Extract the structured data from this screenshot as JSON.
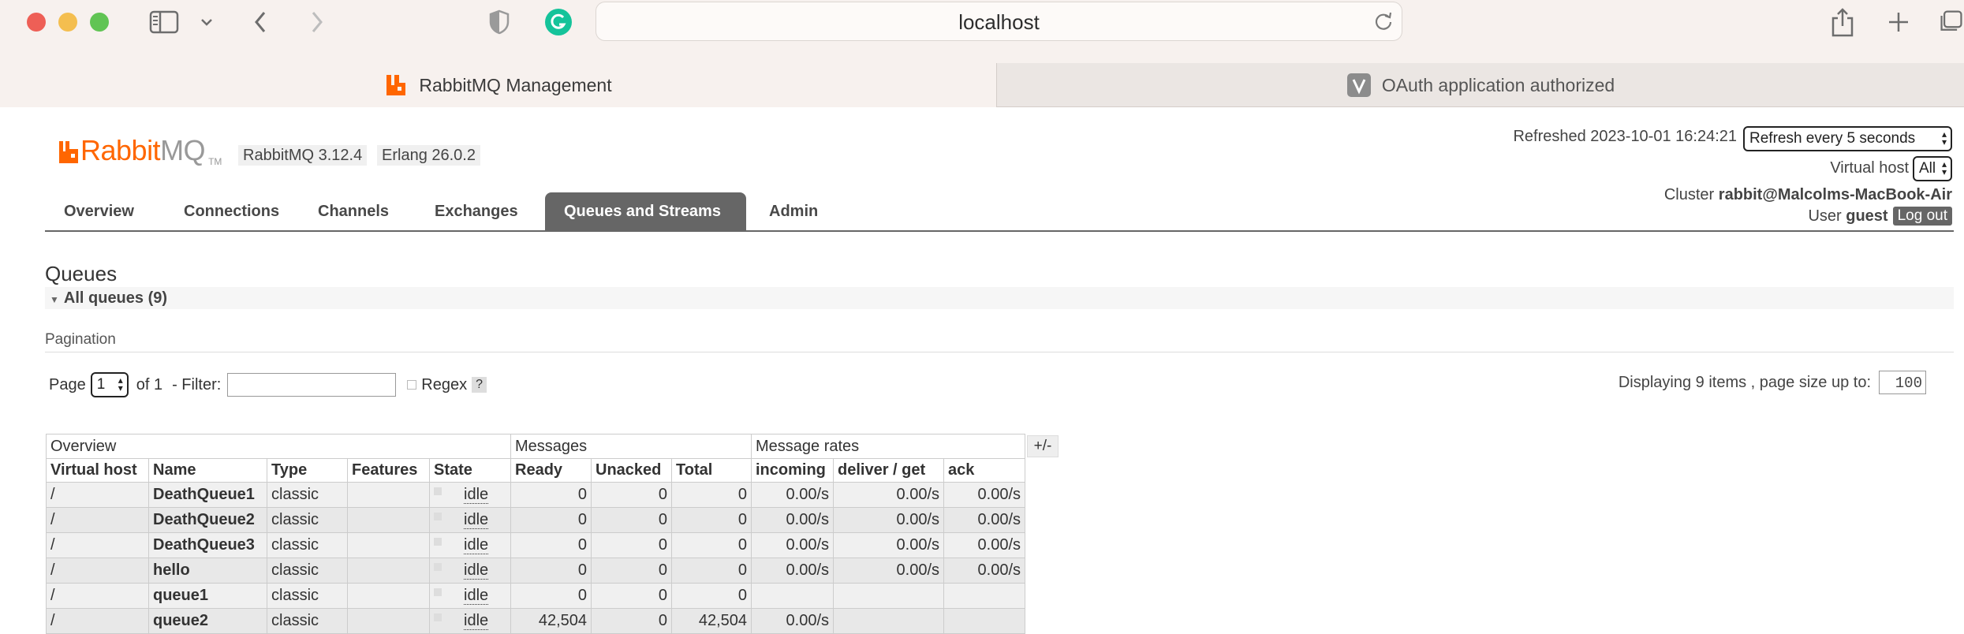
{
  "browser": {
    "url": "localhost",
    "tabs": [
      {
        "label": "RabbitMQ Management",
        "icon": "rabbitmq-logo-icon",
        "active": true
      },
      {
        "label": "OAuth application authorized",
        "icon": "v-logo-icon",
        "active": false
      }
    ],
    "colors": {
      "chrome": "#f7f1ee",
      "close": "#ee5f56",
      "minimize": "#f4be4f",
      "zoom": "#61c454",
      "grammarly": "#15c39a"
    }
  },
  "header": {
    "logo_rabbit": "Rabbit",
    "logo_mq": "MQ",
    "logo_tm": "TM",
    "version": "RabbitMQ 3.12.4",
    "erlang": "Erlang 26.0.2",
    "refreshed": "Refreshed 2023-10-01 16:24:21",
    "refresh_select": "Refresh every 5 seconds",
    "vhost_label": "Virtual host",
    "vhost_select": "All",
    "cluster_label": "Cluster",
    "cluster_name": "rabbit@Malcolms-MacBook-Air",
    "user_label": "User",
    "user_name": "guest",
    "logout": "Log out"
  },
  "nav": {
    "items": [
      "Overview",
      "Connections",
      "Channels",
      "Exchanges",
      "Queues and Streams",
      "Admin"
    ],
    "active": "Queues and Streams"
  },
  "main": {
    "title": "Queues",
    "all_queues": "All queues (9)",
    "pagination_title": "Pagination",
    "page_label": "Page",
    "page_value": "1",
    "of_label": "of 1",
    "filter_label": "- Filter:",
    "regex_label": "Regex",
    "regex_help": "?",
    "displaying": "Displaying 9 items , page size up to:",
    "page_size": "100",
    "plus_minus": "+/-"
  },
  "table": {
    "groups": [
      "Overview",
      "Messages",
      "Message rates"
    ],
    "columns": [
      "Virtual host",
      "Name",
      "Type",
      "Features",
      "State",
      "Ready",
      "Unacked",
      "Total",
      "incoming",
      "deliver / get",
      "ack"
    ],
    "rows": [
      {
        "vhost": "/",
        "name": "DeathQueue1",
        "type": "classic",
        "features": "",
        "state": "idle",
        "ready": "0",
        "unacked": "0",
        "total": "0",
        "incoming": "0.00/s",
        "deliver": "0.00/s",
        "ack": "0.00/s"
      },
      {
        "vhost": "/",
        "name": "DeathQueue2",
        "type": "classic",
        "features": "",
        "state": "idle",
        "ready": "0",
        "unacked": "0",
        "total": "0",
        "incoming": "0.00/s",
        "deliver": "0.00/s",
        "ack": "0.00/s"
      },
      {
        "vhost": "/",
        "name": "DeathQueue3",
        "type": "classic",
        "features": "",
        "state": "idle",
        "ready": "0",
        "unacked": "0",
        "total": "0",
        "incoming": "0.00/s",
        "deliver": "0.00/s",
        "ack": "0.00/s"
      },
      {
        "vhost": "/",
        "name": "hello",
        "type": "classic",
        "features": "",
        "state": "idle",
        "ready": "0",
        "unacked": "0",
        "total": "0",
        "incoming": "0.00/s",
        "deliver": "0.00/s",
        "ack": "0.00/s"
      },
      {
        "vhost": "/",
        "name": "queue1",
        "type": "classic",
        "features": "",
        "state": "idle",
        "ready": "0",
        "unacked": "0",
        "total": "0",
        "incoming": "",
        "deliver": "",
        "ack": ""
      },
      {
        "vhost": "/",
        "name": "queue2",
        "type": "classic",
        "features": "",
        "state": "idle",
        "ready": "42,504",
        "unacked": "0",
        "total": "42,504",
        "incoming": "0.00/s",
        "deliver": "",
        "ack": ""
      }
    ]
  }
}
